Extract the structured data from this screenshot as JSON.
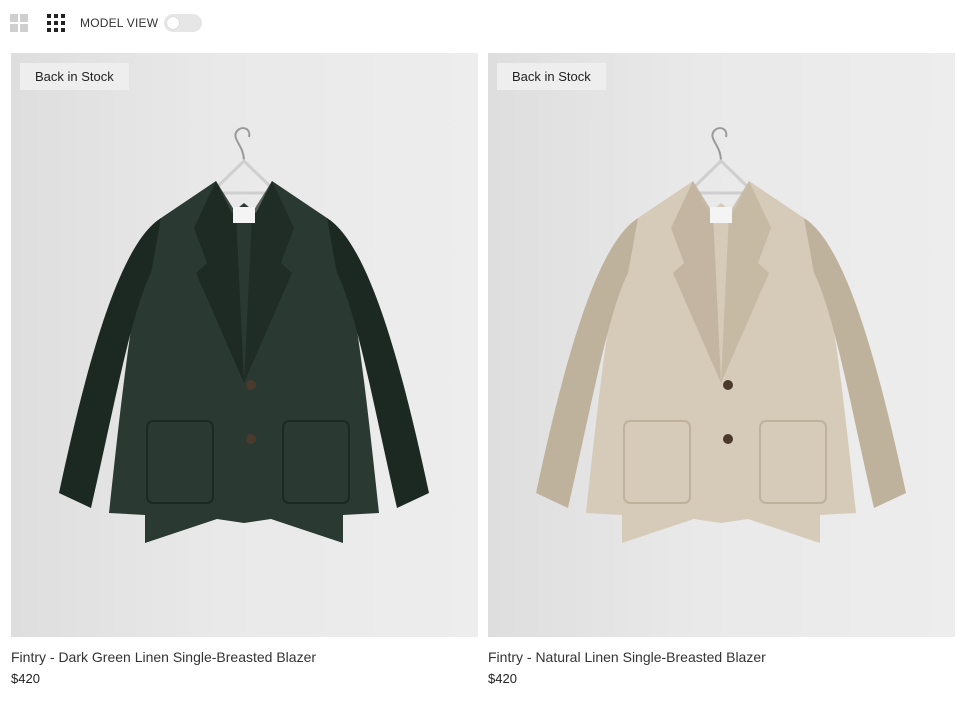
{
  "toolbar": {
    "grid_small_icon": "grid-2x2-icon",
    "grid_large_icon": "grid-3x3-icon",
    "model_view_label": "MODEL VIEW",
    "model_view_on": false
  },
  "products": [
    {
      "badge": "Back in Stock",
      "name": "Fintry - Dark Green Linen Single-Breasted Blazer",
      "price": "$420",
      "color": "#2a3a32",
      "color_dark": "#1c2822"
    },
    {
      "badge": "Back in Stock",
      "name": "Fintry - Natural Linen Single-Breasted Blazer",
      "price": "$420",
      "color": "#d6cbb9",
      "color_dark": "#bfb29c"
    }
  ]
}
